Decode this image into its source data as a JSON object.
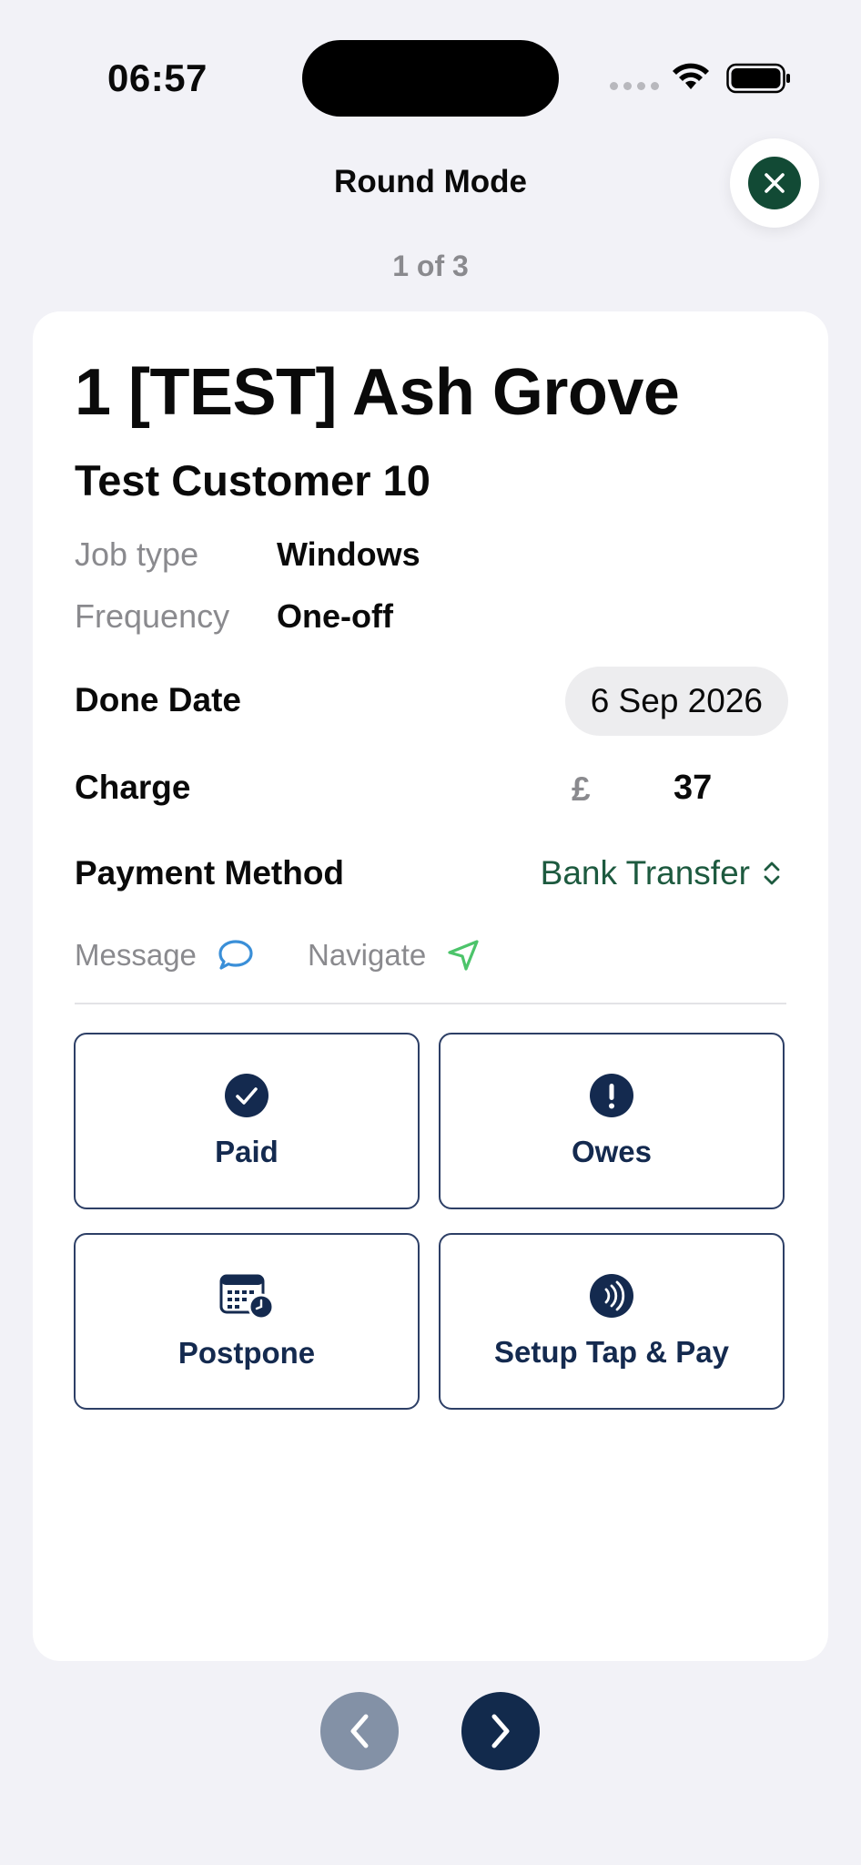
{
  "status_bar": {
    "time": "06:57"
  },
  "header": {
    "title": "Round Mode",
    "progress": "1 of 3"
  },
  "job": {
    "address": "1 [TEST] Ash Grove",
    "customer": "Test Customer 10",
    "job_type_label": "Job type",
    "job_type_value": "Windows",
    "frequency_label": "Frequency",
    "frequency_value": "One-off",
    "done_date_label": "Done Date",
    "done_date_value": "6 Sep 2026",
    "charge_label": "Charge",
    "currency_symbol": "£",
    "charge_value": "37",
    "payment_method_label": "Payment Method",
    "payment_method_value": "Bank Transfer",
    "message_label": "Message",
    "navigate_label": "Navigate"
  },
  "actions": {
    "paid": "Paid",
    "owes": "Owes",
    "postpone": "Postpone",
    "tap_pay": "Setup Tap & Pay"
  },
  "icons": {
    "close": "close-icon",
    "message": "chat-bubble-icon",
    "navigate": "location-arrow-icon",
    "paid": "checkmark-circle-icon",
    "owes": "exclamation-circle-icon",
    "postpone": "calendar-clock-icon",
    "tap_pay": "contactless-icon"
  },
  "colors": {
    "brand_green": "#124a35",
    "navy": "#142a4f",
    "message_blue": "#3a8fd8",
    "navigate_green": "#4cc46a"
  }
}
